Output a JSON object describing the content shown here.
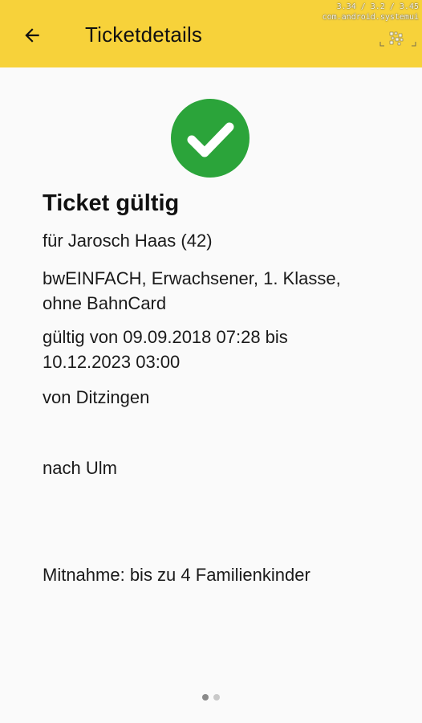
{
  "app_bar": {
    "title": "Ticketdetails",
    "back_icon": "arrow-left-icon",
    "background": "#f7d23a",
    "debug_overlay": {
      "line1": "3.34 / 3.2 / 3.45",
      "line2": "com.android.systemui"
    }
  },
  "ticket": {
    "status_icon": "check-circle-icon",
    "status_color": "#2ba43a",
    "status": "Ticket gültig",
    "passenger": "für Jarosch Haas (42)",
    "product": "bwEINFACH, Erwachsener, 1. Klasse, ohne BahnCard",
    "validity": "gültig von 09.09.2018 07:28 bis 10.12.2023 03:00",
    "from": "von Ditzingen",
    "to": "nach Ulm",
    "companions": "Mitnahme: bis zu 4 Familienkinder"
  },
  "pager": {
    "pages": 2,
    "current": 1
  }
}
